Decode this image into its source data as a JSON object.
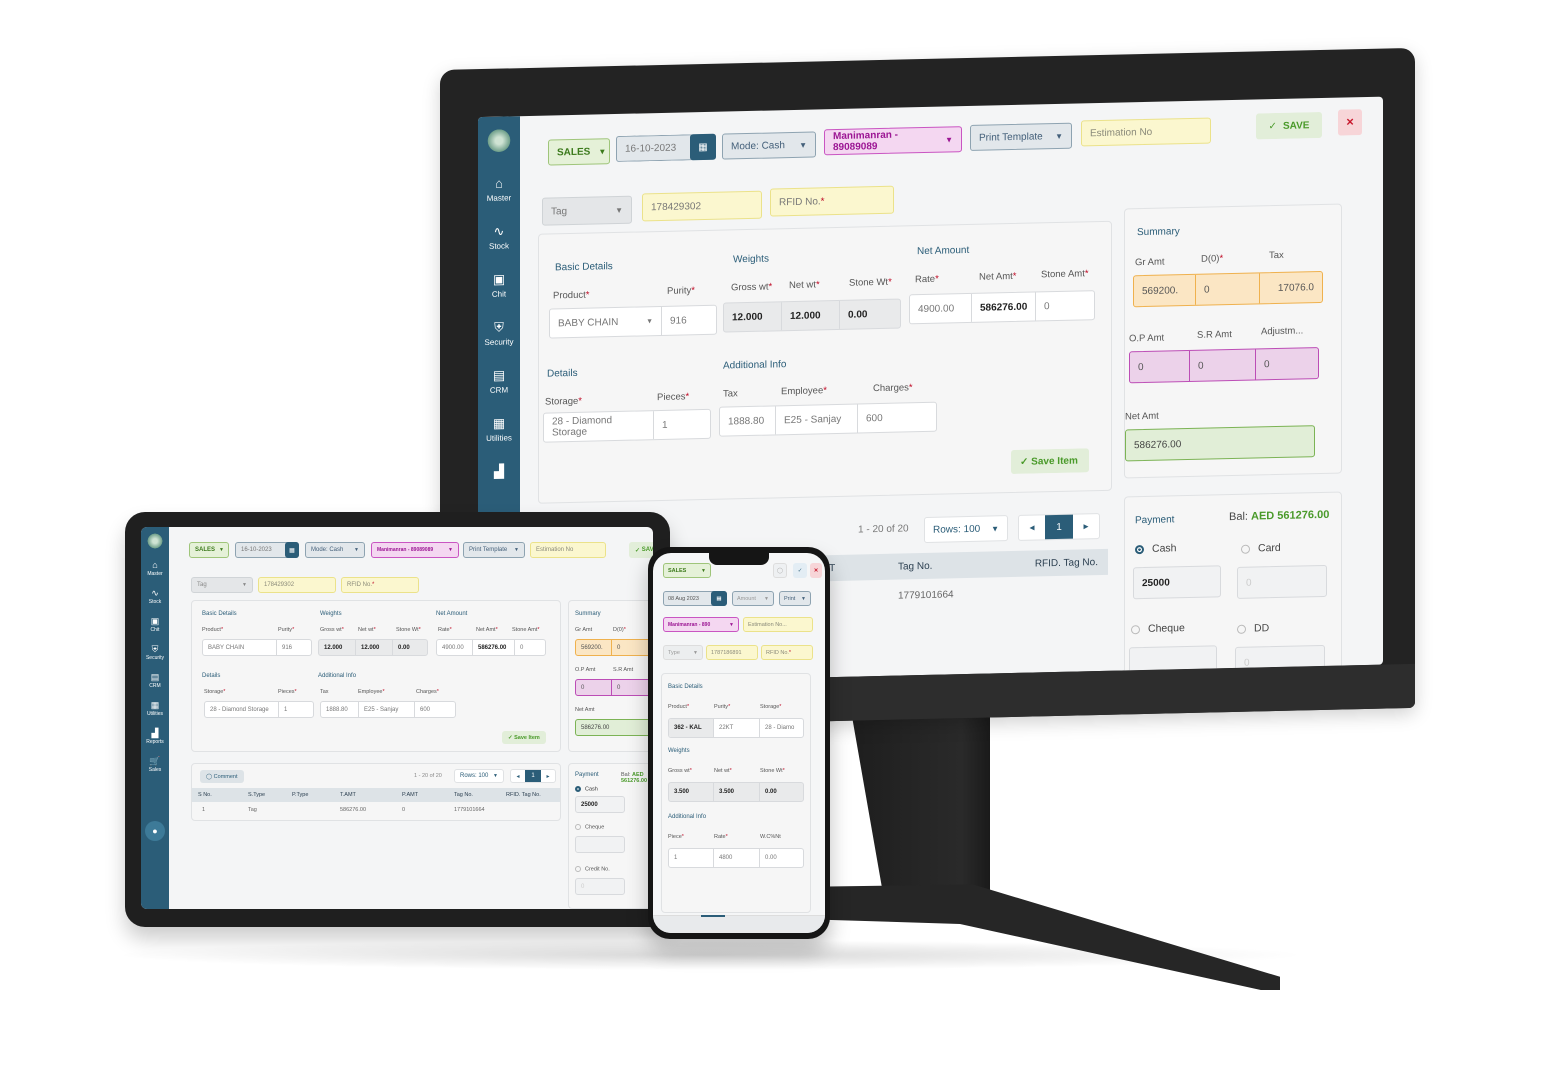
{
  "app": {
    "sidebar": [
      {
        "label": "Master",
        "icon": "home-icon",
        "glyph": "⌂"
      },
      {
        "label": "Stock",
        "icon": "activity-icon",
        "glyph": "∿"
      },
      {
        "label": "Chit",
        "icon": "edit-icon",
        "glyph": "▣"
      },
      {
        "label": "Security",
        "icon": "shield-icon",
        "glyph": "⛨"
      },
      {
        "label": "CRM",
        "icon": "crm-icon",
        "glyph": "▤"
      },
      {
        "label": "Utilities",
        "icon": "file-icon",
        "glyph": "▦"
      },
      {
        "label": "Reports",
        "icon": "bar-chart-icon",
        "glyph": "▟"
      },
      {
        "label": "Sales",
        "icon": "cart-icon",
        "glyph": "🛒"
      }
    ],
    "topbar": {
      "type": "SALES",
      "date": "16-10-2023",
      "mode": "Mode: Cash",
      "customer": "Manimanran - 89089089",
      "print_template": "Print Template",
      "estimation_placeholder": "Estimation No",
      "save": "SAVE",
      "close": "✕",
      "check": "✓",
      "caret": "▼",
      "calendar": "▦"
    },
    "tagrow": {
      "type": "Tag",
      "tag_value": "178429302",
      "rfid_placeholder": "RFID No."
    },
    "basic": {
      "title": "Basic Details",
      "product_label": "Product",
      "purity_label": "Purity",
      "product": "BABY CHAIN",
      "purity": "916"
    },
    "weights": {
      "title": "Weights",
      "gross_label": "Gross wt",
      "net_label": "Net wt",
      "stone_label": "Stone Wt",
      "gross": "12.000",
      "net": "12.000",
      "stone": "0.00"
    },
    "net_amount": {
      "title": "Net Amount",
      "rate_label": "Rate",
      "netamt_label": "Net Amt",
      "stoneamt_label": "Stone Amt",
      "rate": "4900.00",
      "netamt": "586276.00",
      "stoneamt": "0"
    },
    "details": {
      "title": "Details",
      "storage_label": "Storage",
      "pieces_label": "Pieces",
      "storage": "28 - Diamond Storage",
      "pieces": "1"
    },
    "additional": {
      "title": "Additional Info",
      "tax_label": "Tax",
      "employee_label": "Employee",
      "charges_label": "Charges",
      "tax": "1888.80",
      "employee": "E25 - Sanjay",
      "charges": "600"
    },
    "save_item": "✓ Save Item",
    "summary": {
      "title": "Summary",
      "gr_label": "Gr Amt",
      "d_label": "D(0)",
      "tax_label": "Tax",
      "gr": "569200.",
      "d": "0",
      "tax": "17076.0",
      "op_label": "O.P Amt",
      "sr_label": "S.R Amt",
      "adj_label": "Adjustm...",
      "op": "0",
      "sr": "0",
      "adj": "0",
      "net_label": "Net Amt",
      "net": "586276.00"
    },
    "table": {
      "comment": "◯ Comment",
      "range": "1 - 20 of 20",
      "rows": "Rows: 100",
      "page": "1",
      "prev": "◂",
      "next": "▸",
      "columns": [
        "S No.",
        "S.Type",
        "P.Type",
        "T.AMT",
        "P.AMT",
        "Tag No.",
        "RFID. Tag No."
      ],
      "rows_data": [
        [
          "1",
          "Tag",
          "",
          "586276.00",
          "0",
          "1779101664",
          ""
        ]
      ]
    },
    "payment": {
      "title": "Payment",
      "balance_label": "Bal:",
      "balance": "AED 561276.00",
      "cash_label": "Cash",
      "cash": "25000",
      "card_label": "Card",
      "card": "0",
      "cheque_label": "Cheque",
      "dd_label": "DD",
      "dd": "0",
      "credit_label": "Credit No.",
      "credit": "0"
    }
  },
  "phone": {
    "type": "SALES",
    "date": "08 Aug 2023",
    "amount": "Amount",
    "print": "Print",
    "customer": "Manimanran - 890",
    "estimation_placeholder": "Estimation No...",
    "type_select": "Type",
    "tag_value": "1787186891",
    "rfid_placeholder": "RFID No.",
    "basic_title": "Basic Details",
    "product_label": "Product",
    "purity_label": "Purity",
    "storage_label": "Storage",
    "product": "362 - KAL",
    "purity": "22KT",
    "storage": "28 - Diamo",
    "weights_title": "Weights",
    "gross_label": "Gross wt",
    "net_label": "Net wt",
    "stone_label": "Stone Wt",
    "gross": "3.500",
    "net": "3.500",
    "stone": "0.00",
    "additional_title": "Additional Info",
    "piece_label": "Piece",
    "rate_label": "Rate",
    "wc_label": "W.C%Nt",
    "piece": "1",
    "rate": "4800",
    "wc": "0.00"
  },
  "colors": {
    "brand": "#2b5d78",
    "green": "#4a9a2a",
    "pink": "#9c1694",
    "danger": "#c8192d"
  }
}
